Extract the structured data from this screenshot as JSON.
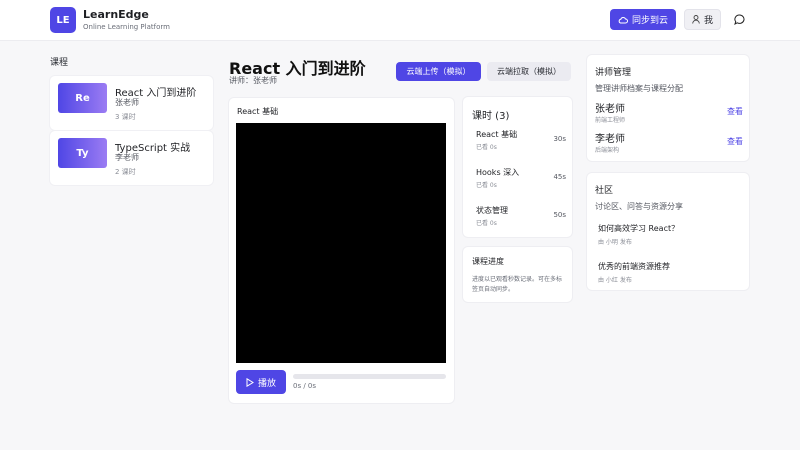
{
  "header": {
    "logo_text": "LE",
    "brand_name": "LearnEdge",
    "brand_sub": "Online Learning Platform",
    "sync_label": "同步到云",
    "me_label": "我",
    "accent": "#4f46e5"
  },
  "sidebar": {
    "heading": "课程",
    "courses": [
      {
        "thumb": "Re",
        "title": "React 入门到进阶",
        "teacher": "张老师",
        "lessons": "3 课时"
      },
      {
        "thumb": "Ty",
        "title": "TypeScript 实战",
        "teacher": "李老师",
        "lessons": "2 课时"
      }
    ]
  },
  "main": {
    "title": "React 入门到进阶",
    "teacher": "讲师：张老师",
    "upload_label": "云端上传（模拟）",
    "pull_label": "云端拉取（模拟）"
  },
  "player": {
    "title": "React 基础",
    "play_label": "播放",
    "time": "0s / 0s",
    "progress": 0
  },
  "lessons": {
    "heading": "课时 (3)",
    "items": [
      {
        "name": "React 基础",
        "watched": "已看 0s",
        "duration": "30s"
      },
      {
        "name": "Hooks 深入",
        "watched": "已看 0s",
        "duration": "45s"
      },
      {
        "name": "状态管理",
        "watched": "已看 0s",
        "duration": "50s"
      }
    ]
  },
  "course_progress": {
    "heading": "课程进度",
    "desc": "进度以已观看秒数记录。可在多标签页自动同步。"
  },
  "teachers": {
    "heading": "讲师管理",
    "sub": "管理讲师档案与课程分配",
    "items": [
      {
        "name": "张老师",
        "role": "前端工程师",
        "action": "查看"
      },
      {
        "name": "李老师",
        "role": "后端架构",
        "action": "查看"
      }
    ]
  },
  "community": {
    "heading": "社区",
    "sub": "讨论区、问答与资源分享",
    "posts": [
      {
        "title": "如何高效学习 React？",
        "meta": "由 小明 发布"
      },
      {
        "title": "优秀的前端资源推荐",
        "meta": "由 小红 发布"
      }
    ]
  }
}
